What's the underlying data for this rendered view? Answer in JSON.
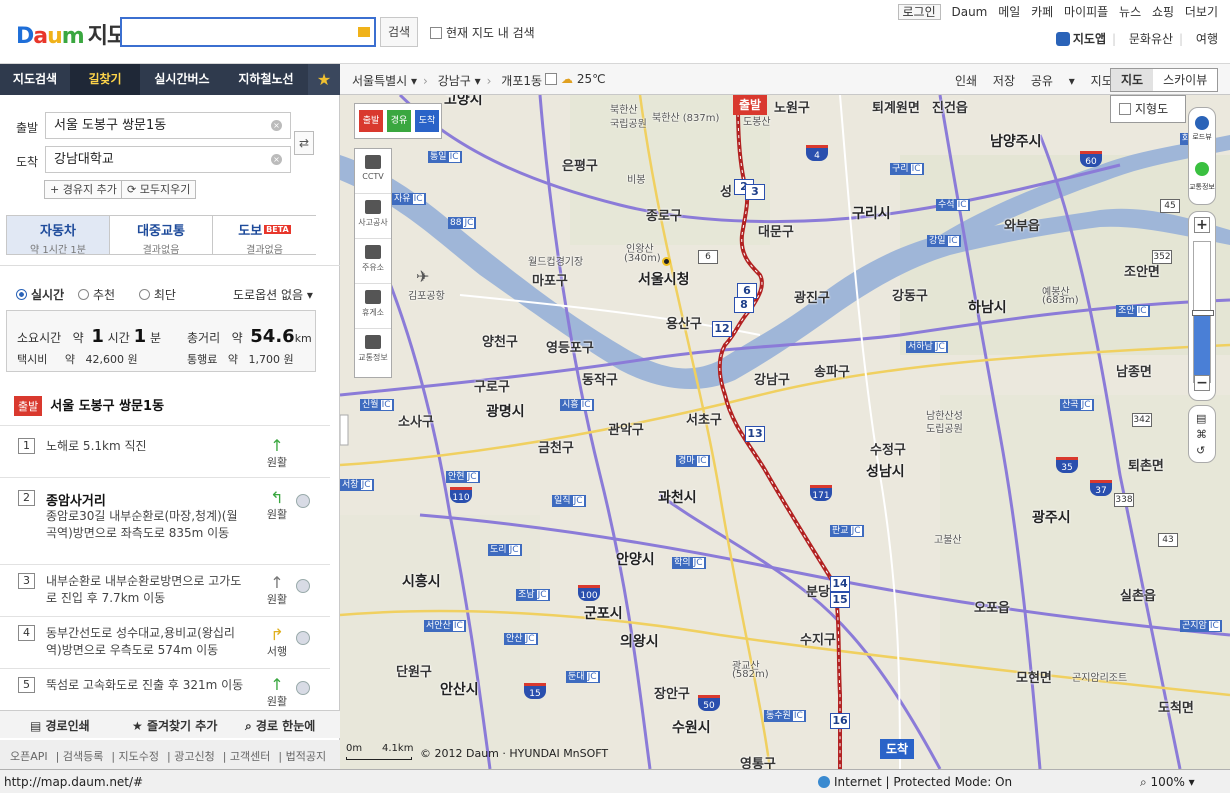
{
  "header": {
    "logo_text": "Daum",
    "title": "지도",
    "search_placeholder": "",
    "search_button": "검색",
    "current_map_search": "현재 지도 내 검색",
    "top_nav": [
      "로그인",
      "Daum",
      "메일",
      "카페",
      "마이피플",
      "뉴스",
      "쇼핑",
      "더보기"
    ],
    "sub_nav": [
      "지도앱",
      "문화유산",
      "여행"
    ]
  },
  "tabs": [
    "지도검색",
    "길찾기",
    "실시간버스",
    "지하철노선"
  ],
  "route": {
    "start_label": "출발",
    "end_label": "도착",
    "start_value": "서울 도봉구 쌍문1동",
    "end_value": "강남대학교",
    "add_waypoint": "+ 경유지 추가",
    "clear_all": "모두지우기",
    "modes": [
      {
        "title": "자동차",
        "sub": "약 1시간 1분"
      },
      {
        "title": "대중교통",
        "sub": "결과없음"
      },
      {
        "title": "도보",
        "sub": "결과없음",
        "badge": "BETA"
      }
    ],
    "options": [
      "실시간",
      "추천",
      "최단"
    ],
    "road_option": "도로옵션 없음",
    "summary": {
      "time_label": "소요시간",
      "approx": "약",
      "hours": "1",
      "hours_unit": "시간",
      "minutes": "1",
      "minutes_unit": "분",
      "distance_label": "총거리",
      "distance": "54.6",
      "distance_unit": "km",
      "taxi_label": "택시비",
      "taxi_value": "42,600 원",
      "toll_label": "통행료",
      "toll_value": "1,700 원"
    },
    "start_badge": "출발",
    "start_place": "서울 도봉구 쌍문1동",
    "steps": [
      {
        "num": "1",
        "title": "",
        "desc": "노해로 5.1km 직진",
        "dir": "원활"
      },
      {
        "num": "2",
        "title": "종암사거리",
        "desc": "종암로30길 내부순환로(마장,청계)(월곡역)방면으로 좌측도로 835m 이동",
        "dir": "원활"
      },
      {
        "num": "3",
        "title": "",
        "desc": "내부순환로 내부순환로방면으로 고가도로 진입 후 7.7km 이동",
        "dir": "원활"
      },
      {
        "num": "4",
        "title": "",
        "desc": "동부간선도로 성수대교,용비교(왕십리역)방면으로 우측도로 574m 이동",
        "dir": "서행"
      },
      {
        "num": "5",
        "title": "",
        "desc": "뚝섬로 고속화도로 진출 후 321m 이동",
        "dir": "원활"
      }
    ],
    "bottom_tools": [
      "경로인쇄",
      "즐겨찾기 추가",
      "경로 한눈에"
    ],
    "footer_links": [
      "오픈API",
      "검색등록",
      "지도수정",
      "광고신청",
      "고객센터",
      "법적공지"
    ]
  },
  "map_toolbar": {
    "breadcrumb": [
      "서울특별시",
      "강남구",
      "개포1동"
    ],
    "weather": "25℃",
    "actions": [
      "인쇄",
      "저장",
      "공유",
      "지도수정"
    ],
    "map_types": [
      "지도",
      "스카이뷰"
    ],
    "terrain": "지형도"
  },
  "map": {
    "flags": {
      "start": "출발",
      "end": "도착"
    },
    "tool_flags": [
      "출발",
      "경유",
      "도착"
    ],
    "side_tools": [
      "CCTV",
      "사고공사",
      "주유소",
      "휴게소",
      "교통정보"
    ],
    "right_tools": [
      "로드뷰",
      "교통정보"
    ],
    "places": [
      {
        "t": "고양시",
        "c": "city"
      },
      {
        "t": "북한산",
        "c": "small"
      },
      {
        "t": "국립공원",
        "c": "small"
      },
      {
        "t": "북한산\n(837m)",
        "c": "small"
      },
      {
        "t": "도봉산",
        "c": "small"
      },
      {
        "t": "노원구",
        "c": ""
      },
      {
        "t": "퇴계원면",
        "c": ""
      },
      {
        "t": "진건읍",
        "c": ""
      },
      {
        "t": "남양주시",
        "c": "city"
      },
      {
        "t": "은평구",
        "c": ""
      },
      {
        "t": "비봉",
        "c": "small"
      },
      {
        "t": "성",
        "c": ""
      },
      {
        "t": "종로구",
        "c": ""
      },
      {
        "t": "구리시",
        "c": "city"
      },
      {
        "t": "와부읍",
        "c": ""
      },
      {
        "t": "인왕산",
        "c": "small"
      },
      {
        "t": "(340m)",
        "c": "small"
      },
      {
        "t": "대문구",
        "c": ""
      },
      {
        "t": "월드컵경기장",
        "c": "small"
      },
      {
        "t": "마포구",
        "c": ""
      },
      {
        "t": "서울시청",
        "c": "city"
      },
      {
        "t": "조안면",
        "c": ""
      },
      {
        "t": "김포공항",
        "c": "small"
      },
      {
        "t": "광진구",
        "c": ""
      },
      {
        "t": "강동구",
        "c": ""
      },
      {
        "t": "예봉산",
        "c": "small"
      },
      {
        "t": "(683m)",
        "c": "small"
      },
      {
        "t": "용산구",
        "c": ""
      },
      {
        "t": "하남시",
        "c": "city"
      },
      {
        "t": "양천구",
        "c": ""
      },
      {
        "t": "영등포구",
        "c": ""
      },
      {
        "t": "동작구",
        "c": ""
      },
      {
        "t": "강남구",
        "c": ""
      },
      {
        "t": "송파구",
        "c": ""
      },
      {
        "t": "남종면",
        "c": ""
      },
      {
        "t": "구로구",
        "c": ""
      },
      {
        "t": "광명시",
        "c": "city"
      },
      {
        "t": "서초구",
        "c": ""
      },
      {
        "t": "남한산성",
        "c": "small"
      },
      {
        "t": "도립공원",
        "c": "small"
      },
      {
        "t": "소사구",
        "c": ""
      },
      {
        "t": "관악구",
        "c": ""
      },
      {
        "t": "금천구",
        "c": ""
      },
      {
        "t": "수정구",
        "c": ""
      },
      {
        "t": "성남시",
        "c": "city"
      },
      {
        "t": "퇴촌면",
        "c": ""
      },
      {
        "t": "과천시",
        "c": "city"
      },
      {
        "t": "광주시",
        "c": "city"
      },
      {
        "t": "안양시",
        "c": "city"
      },
      {
        "t": "분당",
        "c": ""
      },
      {
        "t": "고불산",
        "c": "small"
      },
      {
        "t": "시흥시",
        "c": "city"
      },
      {
        "t": "실촌읍",
        "c": ""
      },
      {
        "t": "군포시",
        "c": "city"
      },
      {
        "t": "오포읍",
        "c": ""
      },
      {
        "t": "의왕시",
        "c": "city"
      },
      {
        "t": "광교산",
        "c": "small"
      },
      {
        "t": "(582m)",
        "c": "small"
      },
      {
        "t": "단원구",
        "c": ""
      },
      {
        "t": "수지구",
        "c": ""
      },
      {
        "t": "모현면",
        "c": ""
      },
      {
        "t": "곤지암리조트",
        "c": "small"
      },
      {
        "t": "안산시",
        "c": "city"
      },
      {
        "t": "장안구",
        "c": ""
      },
      {
        "t": "수원시",
        "c": "city"
      },
      {
        "t": "도척면",
        "c": ""
      },
      {
        "t": "영통구",
        "c": ""
      }
    ],
    "scale_start": "0m",
    "scale_end": "4.1km",
    "copyright": "© 2012 Daum · HYUNDAI MnSOFT"
  },
  "statusbar": {
    "url": "http://map.daum.net/#",
    "zone": "Internet | Protected Mode: On",
    "zoom": "100%"
  }
}
